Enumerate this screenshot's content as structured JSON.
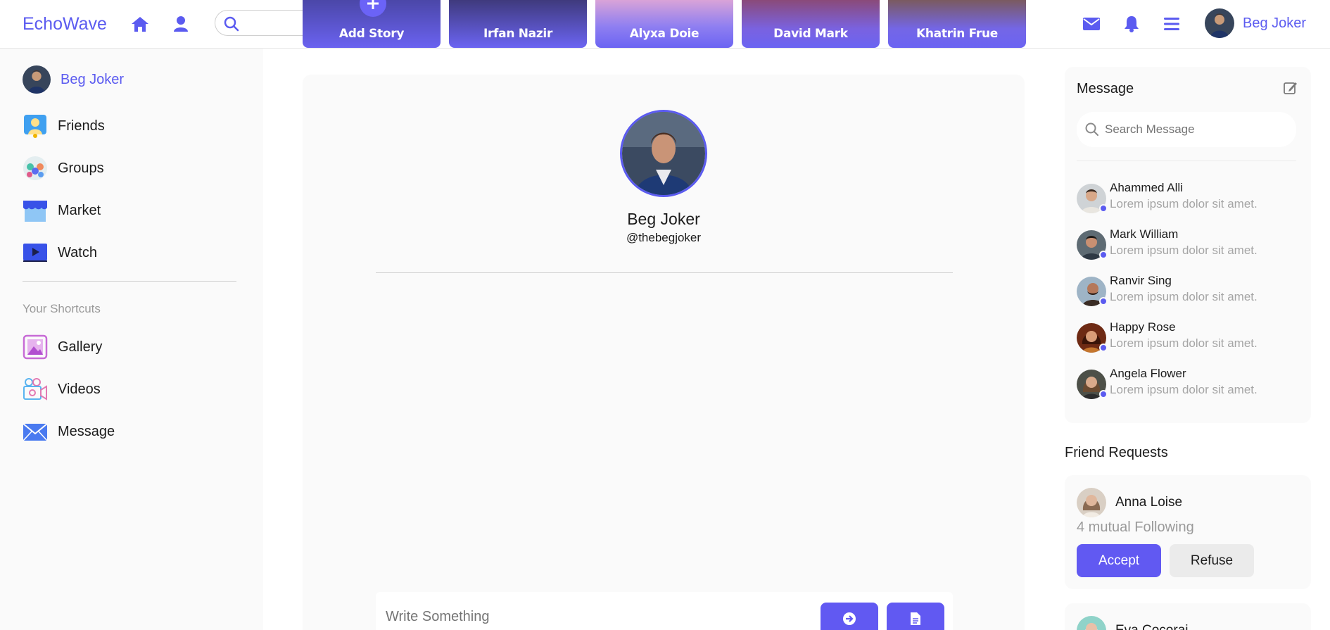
{
  "brand": {
    "logo": "EchoWave",
    "accent": "#5b5bf0"
  },
  "topbar": {
    "search_placeholder": "",
    "user_name": "Beg Joker",
    "icons": [
      "home-icon",
      "user-icon",
      "search-icon",
      "mail-icon",
      "bell-icon",
      "menu-icon"
    ]
  },
  "stories": [
    {
      "label": "Add Story"
    },
    {
      "label": "Irfan Nazir"
    },
    {
      "label": "Alyxa Doie"
    },
    {
      "label": "David Mark"
    },
    {
      "label": "Khatrin Frue"
    }
  ],
  "sidebar": {
    "user_name": "Beg Joker",
    "items": [
      {
        "label": "Friends",
        "icon": "friends-icon"
      },
      {
        "label": "Groups",
        "icon": "groups-icon"
      },
      {
        "label": "Market",
        "icon": "market-icon"
      },
      {
        "label": "Watch",
        "icon": "watch-icon"
      }
    ],
    "shortcuts_title": "Your Shortcuts",
    "shortcuts": [
      {
        "label": "Gallery",
        "icon": "gallery-icon"
      },
      {
        "label": "Videos",
        "icon": "videos-icon"
      },
      {
        "label": "Message",
        "icon": "message-icon"
      }
    ]
  },
  "profile": {
    "name": "Beg Joker",
    "handle": "@thebegjoker",
    "composer_placeholder": "Write Something"
  },
  "messages": {
    "title": "Message",
    "search_placeholder": "Search Message",
    "contacts": [
      {
        "name": "Ahammed Alli",
        "preview": "Lorem ipsum dolor sit amet."
      },
      {
        "name": "Mark William",
        "preview": "Lorem ipsum dolor sit amet."
      },
      {
        "name": "Ranvir Sing",
        "preview": "Lorem ipsum dolor sit amet."
      },
      {
        "name": "Happy Rose",
        "preview": "Lorem ipsum dolor sit amet."
      },
      {
        "name": "Angela Flower",
        "preview": "Lorem ipsum dolor sit amet."
      }
    ]
  },
  "friend_requests": {
    "title": "Friend Requests",
    "requests": [
      {
        "name": "Anna Loise",
        "mutual": "4 mutual Following",
        "accept": "Accept",
        "refuse": "Refuse"
      },
      {
        "name": "Eva Cocorai"
      }
    ]
  }
}
